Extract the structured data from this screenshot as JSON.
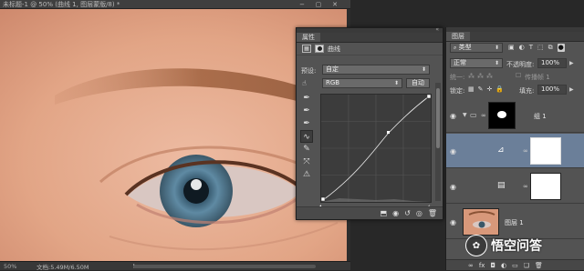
{
  "document": {
    "title": "未标题-1 @ 50% (曲线 1, 图层蒙版/8) *",
    "zoom": "50%",
    "doc_info": "文档:5.49M/6.50M",
    "window_buttons": [
      "−",
      "▢",
      "✕"
    ]
  },
  "properties": {
    "tab_label": "属性",
    "adjustment_name": "曲线",
    "preset_label": "预设:",
    "preset_value": "自定",
    "channel_value": "RGB",
    "auto_button": "自动",
    "footer_icons": [
      "clip-icon",
      "eye-toggle-icon",
      "reset-icon",
      "visibility-icon",
      "trash-icon"
    ]
  },
  "layers": {
    "tab_label": "图层",
    "filter_label": "类型",
    "blend_mode": "正常",
    "opacity_label": "不透明度:",
    "opacity_value": "100%",
    "unify_label": "统一:",
    "propagate_label": "传播帧 1",
    "lock_label": "锁定:",
    "fill_label": "填充:",
    "fill_value": "100%",
    "rows": [
      {
        "name": "组 1"
      },
      {
        "name": ""
      },
      {
        "name": ""
      },
      {
        "name": "图层 1"
      }
    ],
    "footer_icons": [
      "link-icon",
      "fx",
      "mask-icon",
      "adjustment-icon",
      "folder-icon",
      "new-layer-icon",
      "trash-icon"
    ]
  },
  "watermark": {
    "text": "悟空问答"
  },
  "colors": {
    "panel_bg": "#535353",
    "selected_layer": "#6b7f99",
    "canvas_bg": "#3a3a3a"
  }
}
